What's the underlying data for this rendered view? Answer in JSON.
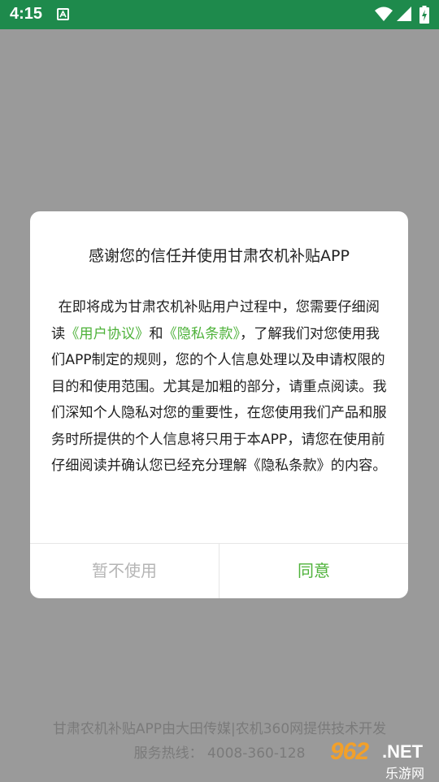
{
  "status_bar": {
    "time": "4:15",
    "app_icon": "accessibility-a-icon",
    "icons": [
      "wifi-icon",
      "signal-icon",
      "battery-charging-icon"
    ],
    "bg_color": "#1e8a4c"
  },
  "dialog": {
    "title": "感谢您的信任并使用甘肃农机补贴APP",
    "body": {
      "part1": "在即将成为甘肃农机补贴用户过程中，您需要仔细阅读",
      "link_user_agreement": "《用户协议》",
      "part2": "和",
      "link_privacy": "《隐私条款》",
      "part3": "，了解我们对您使用我们APP制定的规则，您的个人信息处理以及申请权限的目的和使用范围。尤其是加粗的部分，请重点阅读。我们深知个人隐私对您的重要性，在您使用我们产品和服务时所提供的个人信息将只用于本APP，请您在使用前仔细阅读并确认您已经充分理解《隐私条款》的内容。"
    },
    "decline_label": "暂不使用",
    "agree_label": "同意",
    "accent_color": "#4eb23a"
  },
  "footer": {
    "line1": "甘肃农机补贴APP由大田传媒|农机360网提供技术开发",
    "line2": "服务热线： 4008-360-128"
  },
  "watermark": {
    "number": "962",
    "net": ".NET",
    "sub": "乐游网"
  }
}
